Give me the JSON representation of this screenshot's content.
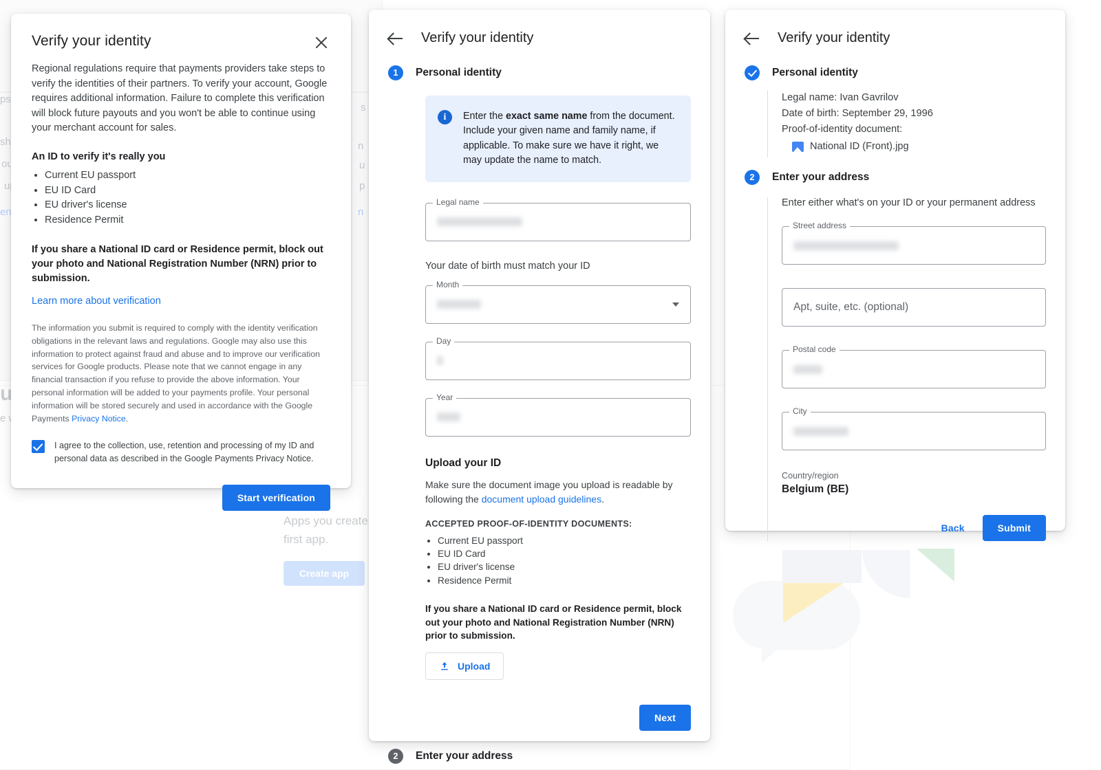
{
  "background": {
    "empty_state_text_1": "Apps you create w",
    "empty_state_text_2": "first app.",
    "create_app_label": "Create app",
    "fragments": [
      "ps",
      "sh",
      "ou",
      "up",
      "en",
      "ui",
      "e w",
      "s",
      "n",
      "u",
      "p",
      "n"
    ]
  },
  "dialog_intro": {
    "title": "Verify your identity",
    "close_icon": "close-icon",
    "body": "Regional regulations require that payments providers take steps to verify the identities of their partners. To verify your account, Google requires additional information. Failure to complete this verification will block future payouts and you won't be able to continue using your merchant account for sales.",
    "subheading": "An ID to verify it's really you",
    "id_list": [
      "Current EU passport",
      "EU ID Card",
      "EU driver's license",
      "Residence Permit"
    ],
    "warning": "If you share a National ID card or Residence permit, block out your photo and National Registration Number (NRN) prior to submission.",
    "learn_more_link": "Learn more about verification",
    "legal_text_before": "The information you submit is required to comply with the identity verification obligations in the relevant laws and regulations. Google may also use this information to protect against fraud and abuse and to improve our verification services for Google products. Please note that we cannot engage in any financial transaction if you refuse to provide the above information. Your personal information will be added to your payments profile. Your personal information will be stored securely and used in accordance with the Google Payments ",
    "legal_link": "Privacy Notice",
    "legal_text_after": ".",
    "consent_label": "I agree to the collection, use, retention and processing of my ID and personal data as described in the Google Payments Privacy Notice.",
    "consent_checked": true,
    "start_button": "Start verification"
  },
  "dialog_step1": {
    "title": "Verify your identity",
    "back_icon": "arrow-left-icon",
    "step1_number": "1",
    "step1_label": "Personal identity",
    "info_text_before": "Enter the ",
    "info_text_bold": "exact same name",
    "info_text_after": " from the document. Include your given name and family name, if applicable. To make sure we have it right, we may update the name to match.",
    "legal_name_label": "Legal name",
    "legal_name_value": "",
    "dob_note": "Your date of birth must match your ID",
    "month_label": "Month",
    "month_value": "",
    "day_label": "Day",
    "day_value": "",
    "year_label": "Year",
    "year_value": "",
    "upload_heading": "Upload your ID",
    "upload_text_before": "Make sure the document image you upload is readable by following the ",
    "upload_link": "document upload guidelines",
    "upload_text_after": ".",
    "accepted_caption": "ACCEPTED PROOF-OF-IDENTITY DOCUMENTS:",
    "accepted_list": [
      "Current EU passport",
      "EU ID Card",
      "EU driver's license",
      "Residence Permit"
    ],
    "warning": "If you share a National ID card or Residence permit, block out your photo and National Registration Number (NRN) prior to submission.",
    "upload_button": "Upload",
    "next_button": "Next",
    "step2_number": "2",
    "step2_label": "Enter your address"
  },
  "dialog_step2": {
    "title": "Verify your identity",
    "back_icon": "arrow-left-icon",
    "step1_label": "Personal identity",
    "summary_legal_name_label": "Legal name:",
    "summary_legal_name_value": "Ivan Gavrilov",
    "summary_dob_label": "Date of birth:",
    "summary_dob_value": "September 29, 1996",
    "summary_doc_label": "Proof-of-identity document:",
    "summary_doc_file": "National ID (Front).jpg",
    "step2_number": "2",
    "step2_label": "Enter your address",
    "address_note": "Enter either what's on your ID or your permanent address",
    "street_label": "Street address",
    "street_value": "",
    "apt_placeholder": "Apt, suite, etc. (optional)",
    "postal_label": "Postal code",
    "postal_value": "",
    "city_label": "City",
    "city_value": "",
    "country_label": "Country/region",
    "country_value": "Belgium (BE)",
    "back_button": "Back",
    "submit_button": "Submit"
  },
  "colors": {
    "accent": "#1a73e8",
    "info_bg": "#e8f0fe",
    "text_primary": "#202124",
    "text_secondary": "#5f6368"
  }
}
